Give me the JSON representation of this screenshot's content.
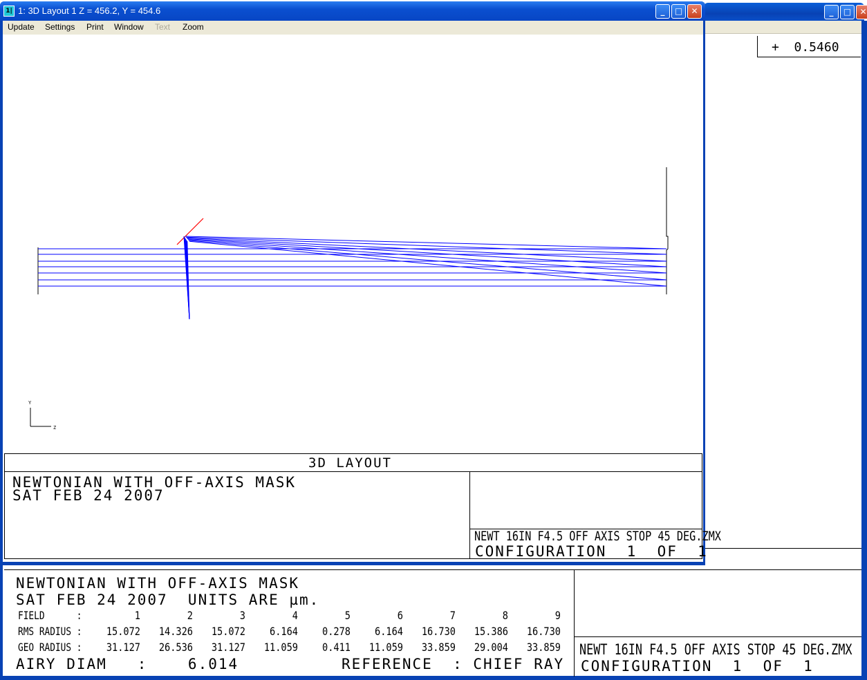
{
  "background_window": {
    "readout": "+  0.5460",
    "spot_footer": {
      "title_line1": "NEWTONIAN WITH OFF-AXIS MASK",
      "title_line2": "SAT FEB 24 2007  UNITS ARE µm.",
      "field_label": "FIELD      :",
      "rms_label": "RMS RADIUS :",
      "geo_label": "GEO RADIUS :",
      "fields": [
        "1",
        "2",
        "3",
        "4",
        "5",
        "6",
        "7",
        "8",
        "9"
      ],
      "rms": [
        "15.072",
        "14.326",
        "15.072",
        "6.164",
        "0.278",
        "6.164",
        "16.730",
        "15.386",
        "16.730"
      ],
      "geo": [
        "31.127",
        "26.536",
        "31.127",
        "11.059",
        "0.411",
        "11.059",
        "33.859",
        "29.004",
        "33.859"
      ],
      "airy": "AIRY DIAM   :    6.014",
      "reference": "REFERENCE  : CHIEF RAY",
      "filename": "NEWT 16IN F4.5 OFF AXIS STOP 45 DEG.ZMX",
      "configuration": "CONFIGURATION  1  OF  1"
    }
  },
  "window": {
    "icon_text": "1|",
    "title": "1: 3D Layout 1 Z = 456.2, Y = 454.6",
    "menu": [
      {
        "label": "Update",
        "enabled": true
      },
      {
        "label": "Settings",
        "enabled": true
      },
      {
        "label": "Print",
        "enabled": true
      },
      {
        "label": "Window",
        "enabled": true
      },
      {
        "label": "Text",
        "enabled": false
      },
      {
        "label": "Zoom",
        "enabled": true
      }
    ],
    "buttons": {
      "minimize": "_",
      "maximize": "□",
      "close": "✕"
    }
  },
  "plot": {
    "axis_y_label": "Y",
    "axis_z_label": "Z",
    "plot_type_label": "3D LAYOUT",
    "title_line1": "NEWTONIAN WITH OFF-AXIS MASK",
    "title_line2": "SAT FEB 24 2007",
    "filename": "NEWT 16IN F4.5 OFF AXIS STOP 45 DEG.ZMX",
    "configuration": "CONFIGURATION  1  OF  1",
    "colors": {
      "rays": "#0000ff",
      "fold_mirror": "#ff0000",
      "surfaces": "#000000"
    }
  }
}
